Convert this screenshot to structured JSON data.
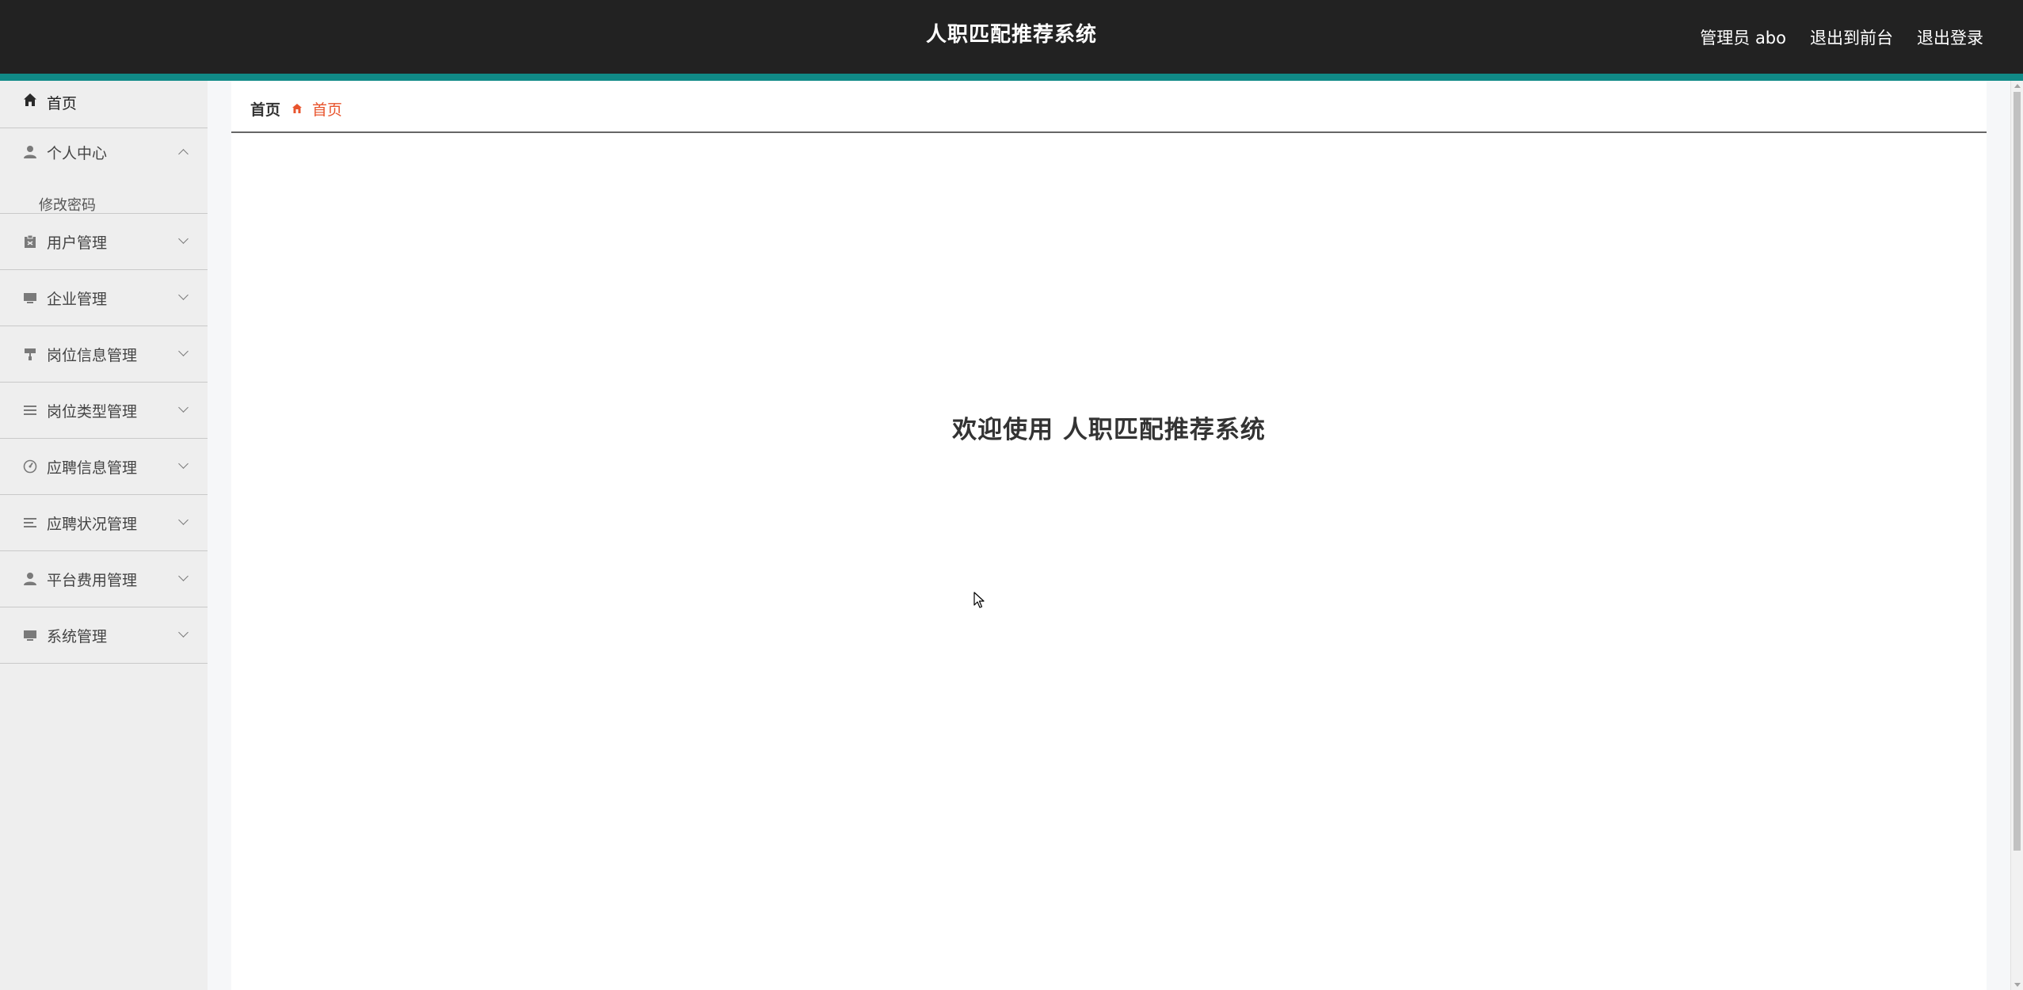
{
  "app": {
    "title": "人职匹配推荐系统"
  },
  "header": {
    "user_label": "管理员 abo",
    "front_link": "退出到前台",
    "logout_link": "退出登录"
  },
  "sidebar": {
    "home": {
      "label": "首页",
      "icon": "home-icon"
    },
    "personal": {
      "label": "个人中心",
      "icon": "user-icon",
      "expanded": true,
      "children": [
        {
          "label": "修改密码"
        }
      ]
    },
    "items": [
      {
        "label": "用户管理",
        "icon": "clipboard-icon"
      },
      {
        "label": "企业管理",
        "icon": "monitor-icon"
      },
      {
        "label": "岗位信息管理",
        "icon": "paint-roller-icon"
      },
      {
        "label": "岗位类型管理",
        "icon": "list-icon"
      },
      {
        "label": "应聘信息管理",
        "icon": "gauge-icon"
      },
      {
        "label": "应聘状况管理",
        "icon": "lines-icon"
      },
      {
        "label": "平台费用管理",
        "icon": "user-icon"
      },
      {
        "label": "系统管理",
        "icon": "monitor-icon"
      }
    ]
  },
  "breadcrumb": {
    "root": "首页",
    "current": "首页"
  },
  "main": {
    "welcome": "欢迎使用 人职匹配推荐系统"
  },
  "colors": {
    "topbar": "#222222",
    "accent": "#108a87",
    "sidebar_bg": "#eeeeee",
    "breadcrumb_current": "#e8542d"
  }
}
